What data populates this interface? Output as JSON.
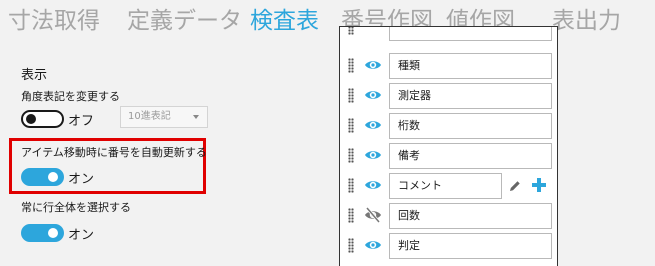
{
  "tabs": [
    {
      "label": "寸法取得",
      "active": false
    },
    {
      "label": "定義データ",
      "active": false
    },
    {
      "label": "検査表",
      "active": true
    },
    {
      "label": "番号作図",
      "active": false
    },
    {
      "label": "値作図",
      "active": false
    },
    {
      "label": "表出力",
      "active": false
    }
  ],
  "settings": {
    "section_title": "表示",
    "angle_notation": {
      "label": "角度表記を変更する",
      "state": "オフ",
      "select_value": "10進表記"
    },
    "auto_renumber": {
      "label": "アイテム移動時に番号を自動更新する",
      "state": "オン"
    },
    "select_entire_row": {
      "label": "常に行全体を選択する",
      "state": "オン"
    }
  },
  "columns": [
    {
      "name": "種類",
      "visible": true
    },
    {
      "name": "測定器",
      "visible": true
    },
    {
      "name": "桁数",
      "visible": true
    },
    {
      "name": "備考",
      "visible": true
    },
    {
      "name": "コメント",
      "visible": true,
      "editable": true
    },
    {
      "name": "回数",
      "visible": false
    },
    {
      "name": "判定",
      "visible": true
    }
  ],
  "colors": {
    "accent": "#2da6dc",
    "highlight": "#e00000",
    "inactive_tab": "#a6a6a6"
  }
}
